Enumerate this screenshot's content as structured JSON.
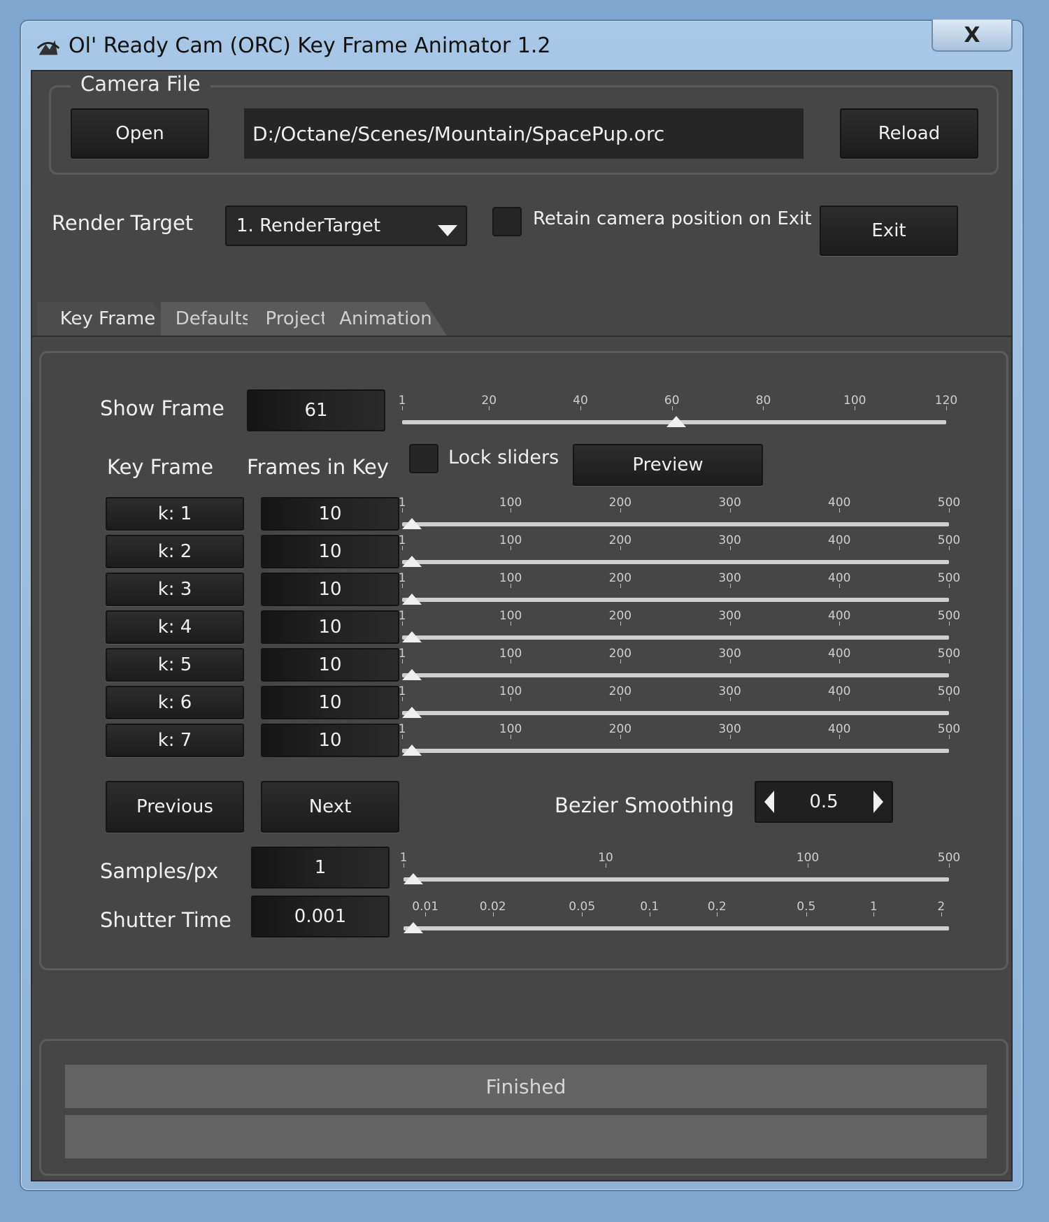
{
  "window": {
    "title": "Ol' Ready Cam (ORC) Key Frame Animator 1.2",
    "close_label": "X"
  },
  "camera_file": {
    "group_title": "Camera File",
    "open_label": "Open",
    "path": "D:/Octane/Scenes/Mountain/SpacePup.orc",
    "reload_label": "Reload"
  },
  "render_target": {
    "label": "Render Target",
    "selected": "1. RenderTarget",
    "retain_label": "Retain camera position on Exit",
    "retain_checked": false,
    "exit_label": "Exit"
  },
  "tabs": [
    {
      "label": "Key Frame",
      "active": true
    },
    {
      "label": "Defaults",
      "active": false
    },
    {
      "label": "Project",
      "active": false
    },
    {
      "label": "Animation",
      "active": false
    }
  ],
  "show_frame": {
    "label": "Show Frame",
    "value": "61",
    "slider_value": 61,
    "slider_min": 1,
    "slider_max": 120,
    "ticks": [
      {
        "label": "1",
        "value": 1
      },
      {
        "label": "20",
        "value": 20
      },
      {
        "label": "40",
        "value": 40
      },
      {
        "label": "60",
        "value": 60
      },
      {
        "label": "80",
        "value": 80
      },
      {
        "label": "100",
        "value": 100
      },
      {
        "label": "120",
        "value": 120
      }
    ]
  },
  "keyframes": {
    "col_key_label": "Key Frame",
    "col_frames_label": "Frames in Key",
    "lock_label": "Lock sliders",
    "lock_checked": false,
    "preview_label": "Preview",
    "slider_min": 1,
    "slider_max": 500,
    "ticks": [
      {
        "label": "1",
        "value": 1
      },
      {
        "label": "100",
        "value": 100
      },
      {
        "label": "200",
        "value": 200
      },
      {
        "label": "300",
        "value": 300
      },
      {
        "label": "400",
        "value": 400
      },
      {
        "label": "500",
        "value": 500
      }
    ],
    "rows": [
      {
        "key": "k: 1",
        "frames": "10",
        "slider_value": 10
      },
      {
        "key": "k: 2",
        "frames": "10",
        "slider_value": 10
      },
      {
        "key": "k: 3",
        "frames": "10",
        "slider_value": 10
      },
      {
        "key": "k: 4",
        "frames": "10",
        "slider_value": 10
      },
      {
        "key": "k: 5",
        "frames": "10",
        "slider_value": 10
      },
      {
        "key": "k: 6",
        "frames": "10",
        "slider_value": 10
      },
      {
        "key": "k: 7",
        "frames": "10",
        "slider_value": 10
      }
    ]
  },
  "nav": {
    "previous_label": "Previous",
    "next_label": "Next"
  },
  "bezier": {
    "label": "Bezier Smoothing",
    "value": "0.5"
  },
  "samples": {
    "label": "Samples/px",
    "value": "1",
    "slider_value": 1,
    "scale": "log",
    "slider_min": 1,
    "slider_max": 500,
    "ticks": [
      {
        "label": "1",
        "value": 1
      },
      {
        "label": "10",
        "value": 10
      },
      {
        "label": "100",
        "value": 100
      },
      {
        "label": "500",
        "value": 500
      }
    ]
  },
  "shutter": {
    "label": "Shutter Time",
    "value": "0.001",
    "slider_value": 0.001,
    "scale": "log",
    "ticks": [
      {
        "label": "0.01",
        "value": 0.01
      },
      {
        "label": "0.02",
        "value": 0.02
      },
      {
        "label": "0.05",
        "value": 0.05
      },
      {
        "label": "0.1",
        "value": 0.1
      },
      {
        "label": "0.2",
        "value": 0.2
      },
      {
        "label": "0.5",
        "value": 0.5
      },
      {
        "label": "1",
        "value": 1
      },
      {
        "label": "2",
        "value": 2
      }
    ]
  },
  "status": {
    "text": "Finished",
    "progress": 0
  }
}
